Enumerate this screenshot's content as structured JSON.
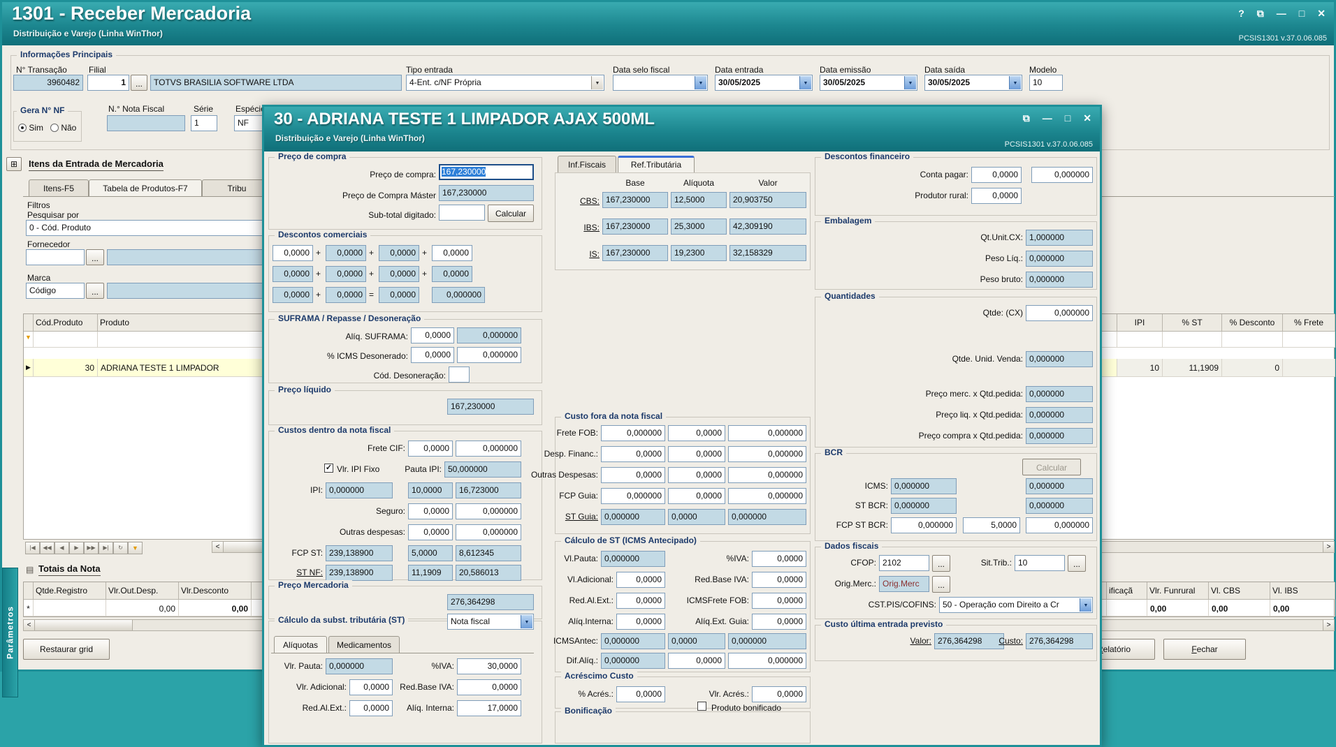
{
  "theme": {
    "titlebar_teal": "#1E8A92",
    "desktop_teal": "#2BA3A8",
    "readonly_field": "#C3DAE5",
    "selection_blue": "#2F80D8",
    "row_highlight": "#FFFFD8",
    "group_caption": "#1C3A6B"
  },
  "sym": {
    "help": "?",
    "pin": "⧉",
    "min": "—",
    "max": "□",
    "close": "✕",
    "ellipsis": "...",
    "arrow": "▼",
    "plus": "+",
    "equals": "=",
    "lt": "<",
    "gt": ">",
    "funnel": "▼",
    "grid_icon": "⊞",
    "list_icon": "▤",
    "row_marker": "▶",
    "asterisk": "*",
    "check": "✓"
  },
  "main": {
    "title": "1301 - Receber Mercadoria",
    "subtitle": "Distribuição e Varejo (Linha WinThor)",
    "version": "PCSIS1301  v.37.0.06.085",
    "info": {
      "group": "Informações Principais",
      "transacao_label": "N° Transação",
      "transacao": "3960482",
      "filial_label": "Filial",
      "filial": "1",
      "filial_nome": "TOTVS BRASILIA SOFTWARE LTDA",
      "tipo_label": "Tipo entrada",
      "tipo": "4-Ent. c/NF Própria",
      "selo_label": "Data selo fiscal",
      "selo": "",
      "entrada_label": "Data entrada",
      "entrada": "30/05/2025",
      "emissao_label": "Data emissão",
      "emissao": "30/05/2025",
      "saida_label": "Data saída",
      "saida": "30/05/2025",
      "modelo_label": "Modelo",
      "modelo": "10",
      "gera_label": "Gera N° NF",
      "sim": "Sim",
      "nao": "Não",
      "nf_label": "N.° Nota Fiscal",
      "nf": "",
      "serie_label": "Série",
      "serie": "1",
      "especie_label": "Espécie",
      "especie": "NF"
    },
    "itens": {
      "header": "Itens da Entrada de Mercadoria",
      "tabs": [
        "Itens-F5",
        "Tabela de Produtos-F7",
        "Tribu"
      ],
      "filtros": "Filtros",
      "pesquisar_label": "Pesquisar por",
      "pesquisar": "0 - Cód. Produto",
      "fornecedor_label": "Fornecedor",
      "fornecedor": "",
      "fornecedor_nome": "",
      "marca_label": "Marca",
      "marca": "Código",
      "marca_nome": "",
      "cols": [
        "Cód.Produto",
        "Produto",
        "IPI",
        "% ST",
        "% Desconto",
        "% Frete"
      ],
      "row": {
        "cod": "30",
        "produto": "ADRIANA TESTE 1 LIMPADOR",
        "ipi": "10",
        "st": "11,1909",
        "desconto": "0",
        "frete": ""
      }
    },
    "navigator": [
      "|◀",
      "◀◀",
      "◀",
      "▶",
      "▶▶",
      "▶|",
      "↻"
    ],
    "totais": {
      "header": "Totais da Nota",
      "cols": [
        "Qtde.Registro",
        "Vlr.Out.Desp.",
        "Vlr.Desconto",
        "ificaçã",
        "Vlr. Funrural",
        "Vl. CBS",
        "Vl. IBS"
      ],
      "v1": "0,00",
      "v2": "0,00",
      "v3": "0,00",
      "v4": "0,00",
      "v5": "0,00"
    },
    "buttons": {
      "restaurar": "Restaurar grid",
      "relatorio_u": "R",
      "relatorio_rest": "elatório",
      "fechar_u": "F",
      "fechar_rest": "echar"
    },
    "parametros": "Parâmetros"
  },
  "modal": {
    "title": "30 - ADRIANA TESTE 1 LIMPADOR AJAX 500ML",
    "subtitle": "Distribuição e Varejo (Linha WinThor)",
    "version": "PCSIS1301  v.37.0.06.085",
    "preco_compra": {
      "group": "Preço de compra",
      "l1": "Preço de compra:",
      "v1": "167,230000",
      "l2": "Preço de Compra Máster",
      "v2": "167,230000",
      "l3": "Sub-total digitado:",
      "v3": "",
      "calcular": "Calcular"
    },
    "desc_com": {
      "group": "Descontos comerciais",
      "r1": [
        "0,0000",
        "0,0000",
        "0,0000",
        "0,0000"
      ],
      "r2": [
        "0,0000",
        "0,0000",
        "0,0000",
        "0,0000"
      ],
      "r3": [
        "0,0000",
        "0,0000",
        "0,0000",
        "0,000000"
      ]
    },
    "suframa": {
      "group": "SUFRAMA / Repasse / Desoneração",
      "aliq_label": "Alíq. SUFRAMA:",
      "aliq1": "0,0000",
      "aliq2": "0,000000",
      "icms_label": "% ICMS Desonerado:",
      "icms1": "0,0000",
      "icms2": "0,000000",
      "cod_label": "Cód. Desoneração:",
      "cod": ""
    },
    "preco_liq": {
      "group": "Preço líquido",
      "v": "167,230000"
    },
    "custos": {
      "group": "Custos dentro da nota fiscal",
      "frete_label": "Frete CIF:",
      "frete1": "0,0000",
      "frete2": "0,000000",
      "ipifixo": "Vlr. IPI Fixo",
      "pauta_label": "Pauta IPI:",
      "pauta": "50,000000",
      "ipi_label": "IPI:",
      "ipi1": "0,000000",
      "ipi2": "10,0000",
      "ipi3": "16,723000",
      "seguro_label": "Seguro:",
      "seguro1": "0,0000",
      "seguro2": "0,000000",
      "outras_label": "Outras despesas:",
      "outras1": "0,0000",
      "outras2": "0,000000",
      "fcpst_label": "FCP ST:",
      "fcpst1": "239,138900",
      "fcpst2": "5,0000",
      "fcpst3": "8,612345",
      "stnf_label": "ST NF:",
      "stnf1": "239,138900",
      "stnf2": "11,1909",
      "stnf3": "20,586013"
    },
    "preco_merc": {
      "group": "Preço Mercadoria",
      "v": "276,364298"
    },
    "calc_st": {
      "group": "Cálculo da subst. tributária (ST)",
      "combo": "Nota fiscal",
      "tabs": [
        "Alíquotas",
        "Medicamentos"
      ],
      "pauta_label": "Vlr. Pauta:",
      "pauta": "0,000000",
      "iva_label": "%IVA:",
      "iva": "30,0000",
      "adic_label": "Vlr. Adicional:",
      "adic": "0,0000",
      "redbase_label": "Red.Base IVA:",
      "redbase": "0,0000",
      "redal_label": "Red.Al.Ext.:",
      "redal": "0,0000",
      "aliqint_label": "Alíq. Interna:",
      "aliqint": "17,0000"
    },
    "fiscal_tabs": [
      "Inf.Fiscais",
      "Ref.Tributária"
    ],
    "ref": {
      "cols": [
        "Base",
        "Alíquota",
        "Valor"
      ],
      "cbs_label": "CBS:",
      "cbs": [
        "167,230000",
        "12,5000",
        "20,903750"
      ],
      "ibs_label": "IBS:",
      "ibs": [
        "167,230000",
        "25,3000",
        "42,309190"
      ],
      "is_label": "IS:",
      "is": [
        "167,230000",
        "19,2300",
        "32,158329"
      ]
    },
    "fora": {
      "group": "Custo fora da nota fiscal",
      "r0_label": "Frete FOB:",
      "r0": [
        "0,000000",
        "0,0000",
        "0,000000"
      ],
      "r1_label": "Desp. Financ.:",
      "r1": [
        "0,0000",
        "0,0000",
        "0,000000"
      ],
      "r2_label": "Outras Despesas:",
      "r2": [
        "0,0000",
        "0,0000",
        "0,000000"
      ],
      "r3_label": "FCP Guia:",
      "r3": [
        "0,000000",
        "0,0000",
        "0,000000"
      ],
      "r4_label": "ST Guia:",
      "r4": [
        "0,000000",
        "0,0000",
        "0,000000"
      ]
    },
    "icmsant": {
      "group": "Cálculo de ST (ICMS Antecipado)",
      "vlpauta_label": "Vl.Pauta:",
      "vlpauta": "0,000000",
      "iva_label": "%IVA:",
      "iva": "0,0000",
      "vladic_label": "Vl.Adicional:",
      "vladic": "0,0000",
      "redbase_label": "Red.Base IVA:",
      "redbase": "0,0000",
      "redal_label": "Red.Al.Ext.:",
      "redal": "0,0000",
      "icmsfrete_label": "ICMSFrete FOB:",
      "icmsfrete": "0,0000",
      "aliqint_label": "Alíq.Interna:",
      "aliqint": "0,0000",
      "aliqext_label": "Alíq.Ext. Guia:",
      "aliqext": "0,0000",
      "antec_label": "ICMSAntec:",
      "antec": [
        "0,000000",
        "0,0000",
        "0,000000"
      ],
      "dif_label": "Dif.Alíq.:",
      "dif": [
        "0,000000",
        "0,0000",
        "0,000000"
      ]
    },
    "acres": {
      "group": "Acréscimo Custo",
      "p_label": "% Acrés.:",
      "p": "0,0000",
      "v_label": "Vlr. Acrés.:",
      "v": "0,0000"
    },
    "bonif": {
      "group": "Bonificação",
      "check": "Produto bonificado"
    },
    "descfin": {
      "group": "Descontos financeiro",
      "conta_label": "Conta pagar:",
      "conta1": "0,0000",
      "conta2": "0,000000",
      "prod_label": "Produtor rural:",
      "prod": "0,0000"
    },
    "emb": {
      "group": "Embalagem",
      "qt_label": "Qt.Unit.CX:",
      "qt": "1,000000",
      "pliq_label": "Peso Líq.:",
      "pliq": "0,000000",
      "pbruto_label": "Peso bruto:",
      "pbruto": "0,000000"
    },
    "qtd": {
      "group": "Quantidades",
      "qtde_label": "Qtde: (CX)",
      "qtde": "0,000000",
      "uv_label": "Qtde. Unid. Venda:",
      "uv": "0,000000",
      "pm_label": "Preço merc. x Qtd.pedida:",
      "pm": "0,000000",
      "pl_label": "Preço liq. x Qtd.pedida:",
      "pl": "0,000000",
      "pc_label": "Preço compra x Qtd.pedida:",
      "pc": "0,000000"
    },
    "bcr": {
      "group": "BCR",
      "calcular": "Calcular",
      "icms_label": "ICMS:",
      "icms1": "0,000000",
      "icms2": "0,000000",
      "st_label": "ST BCR:",
      "st1": "0,000000",
      "st2": "0,000000",
      "fcp_label": "FCP ST BCR:",
      "fcp1": "0,000000",
      "fcp2": "5,0000",
      "fcp3": "0,000000"
    },
    "df": {
      "group": "Dados fiscais",
      "cfop_label": "CFOP:",
      "cfop": "2102",
      "sit_label": "Sit.Trib.:",
      "sit": "10",
      "orig_label": "Orig.Merc.:",
      "orig": "Orig.Merc",
      "cst_label": "CST.PIS/COFINS:",
      "cst": "50 - Operação com Direito a Cr"
    },
    "ult": {
      "group": "Custo última entrada previsto",
      "valor_label": "Valor:",
      "valor": "276,364298",
      "custo_label": "Custo:",
      "custo": "276,364298"
    }
  }
}
